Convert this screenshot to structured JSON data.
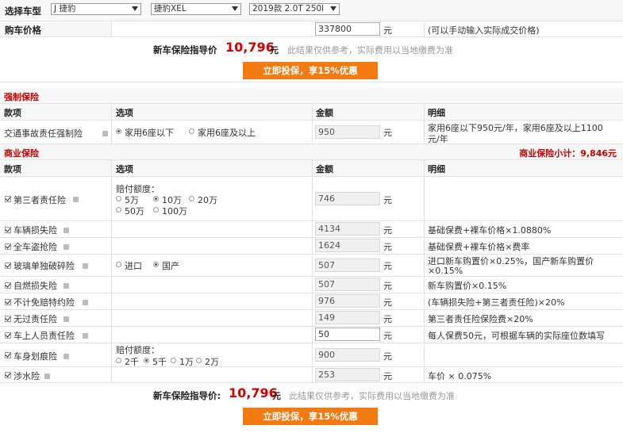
{
  "selector": {
    "label": "选择车型",
    "brand": "J 捷豹",
    "series": "捷豹XEL",
    "model": "2019款 2.0T 250l"
  },
  "price": {
    "label": "购车价格",
    "value": "337800",
    "unit": "元",
    "note": "(可以手动输入实际成交价格)"
  },
  "guide": {
    "label": "新车保险指导价",
    "label2": "新车保险指导价:",
    "amount": "10,796",
    "unit": "元",
    "note": "此结果仅供参考，实际费用以当地缴费为准",
    "button": "立即投保，享15%优惠"
  },
  "compulsory": {
    "section": "强制保险",
    "headers": [
      "款项",
      "选项",
      "金额",
      "明细"
    ],
    "item": {
      "name": "交通事故责任强制险",
      "opt1": "家用6座以下",
      "opt2": "家用6座及以上",
      "amount": "950",
      "unit": "元",
      "detail1": "家用6座以下950元/年，家用6座及以上1100",
      "detail2": "元/年"
    }
  },
  "commercial": {
    "section": "商业保险",
    "subtotal": "商业保险小计：9,846元",
    "headers": [
      "款项",
      "选项",
      "金额",
      "明细"
    ],
    "third": {
      "name": "第三者责任险",
      "opt_label": "赔付额度：",
      "opts": [
        "5万",
        "10万",
        "20万",
        "50万",
        "100万"
      ],
      "amount": "746",
      "unit": "元"
    },
    "damage": {
      "name": "车辆损失险",
      "amount": "4134",
      "unit": "元",
      "detail": "基础保费+裸车价格×1.0880%"
    },
    "theft": {
      "name": "全车盗抢险",
      "amount": "1624",
      "unit": "元",
      "detail": "基础保费+裸车价格×费率"
    },
    "glass": {
      "name": "玻璃单独破碎险",
      "opt1": "进口",
      "opt2": "国产",
      "amount": "507",
      "unit": "元",
      "detail1": "进口新车购置价×0.25%，国产新车购置价",
      "detail2": "×0.15%"
    },
    "fire": {
      "name": "自燃损失险",
      "amount": "507",
      "unit": "元",
      "detail": "新车购置价×0.15%"
    },
    "deduct": {
      "name": "不计免赔特约险",
      "amount": "976",
      "unit": "元",
      "detail": "(车辆损失险+第三者责任险)×20%"
    },
    "nofault": {
      "name": "无过责任险",
      "amount": "149",
      "unit": "元",
      "detail": "第三者责任险保险费×20%"
    },
    "seat": {
      "name": "车上人员责任险",
      "amount": "50",
      "unit": "元",
      "detail": "每人保费50元，可根据车辆的实际座位数填写"
    },
    "scratch": {
      "name": "车身划痕险",
      "opt_label": "赔付额度：",
      "opts": [
        "2千",
        "5千",
        "1万",
        "2万"
      ],
      "amount": "900",
      "unit": "元"
    },
    "water": {
      "name": "涉水险",
      "amount": "253",
      "unit": "元",
      "detail": "车价 × 0.075%"
    }
  }
}
